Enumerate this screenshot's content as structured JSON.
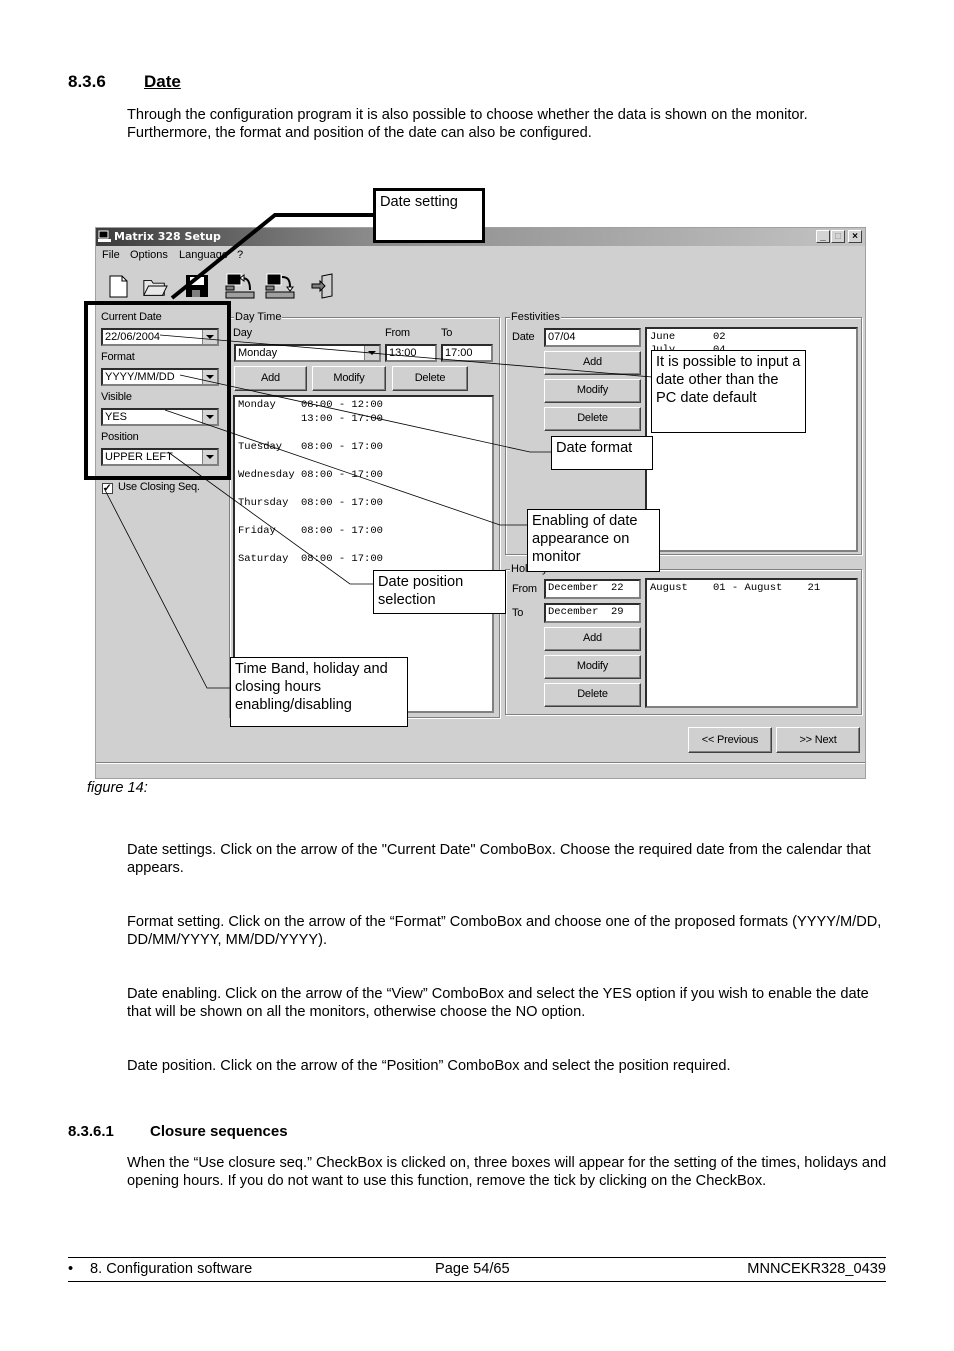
{
  "section": {
    "number": "8.3.6",
    "title": "Date"
  },
  "intro": [
    "Through the configuration program it is also possible to choose whether the data is shown on the monitor.",
    "Furthermore, the format and position of the date can also be configured."
  ],
  "window": {
    "title": "Matrix 328 Setup",
    "controls": {
      "minimize": "_",
      "maximize": "□",
      "close": "×"
    },
    "menu": [
      "File",
      "Options",
      "Language",
      "?"
    ],
    "toolbar": [
      "new-file-icon",
      "open-folder-icon",
      "save-floppy-icon",
      "receive-from-device-icon",
      "send-to-device-icon",
      "exit-door-icon"
    ],
    "date_panel": {
      "current_date_label": "Current Date",
      "current_date_value": "22/06/2004",
      "format_label": "Format",
      "format_value": "YYYY/MM/DD",
      "visible_label": "Visible",
      "visible_value": "YES",
      "position_label": "Position",
      "position_value": "UPPER LEFT",
      "closing_seq_label": "Use Closing Seq.",
      "closing_seq_checked": true
    },
    "day_time": {
      "title": "Day Time",
      "day_label": "Day",
      "from_label": "From",
      "to_label": "To",
      "day_value": "Monday",
      "from_value": "13:00",
      "to_value": "17:00",
      "add": "Add",
      "modify": "Modify",
      "delete": "Delete",
      "entries": [
        "Monday    08:00 - 12:00",
        "          13:00 - 17:00",
        "Tuesday   08:00 - 17:00",
        "Wednesday 08:00 - 17:00",
        "Thursday  08:00 - 17:00",
        "Friday    08:00 - 17:00",
        "Saturday  08:00 - 17:00"
      ]
    },
    "festivities": {
      "title": "Festivities",
      "date_label": "Date",
      "date_value": "07/04",
      "add": "Add",
      "modify": "Modify",
      "delete": "Delete",
      "entries": [
        "June      02",
        "July      04"
      ]
    },
    "holidays": {
      "title": "Holidays",
      "from_label": "From",
      "to_label": "To",
      "from_value": "December  22",
      "to_value": "December  29",
      "add": "Add",
      "modify": "Modify",
      "delete": "Delete",
      "entries": [
        "August    01 - August    21"
      ]
    },
    "nav": {
      "previous": "<< Previous",
      "next": ">> Next"
    }
  },
  "callouts": {
    "date_setting": "Date setting",
    "other_date": "It is possible to input a date other than the PC date default",
    "date_format": "Date format",
    "enabling": "Enabling of date appearance on monitor",
    "position": "Date position selection",
    "time_band": "Time Band, holiday and closing hours enabling/disabling"
  },
  "caption": "figure 14:",
  "body": [
    "Date settings. Click on the arrow of the \"Current Date\" ComboBox. Choose the required date from the calendar that appears.",
    "Format setting. Click on the arrow of the “Format” ComboBox and choose one of the proposed formats (YYYY/M/DD, DD/MM/YYYY, MM/DD/YYYY).",
    "Date enabling. Click on the arrow of the “View”  ComboBox and select the YES option if you wish to enable the date that will be shown on all the monitors, otherwise choose the NO option.",
    "Date position. Click on the arrow of the “Position” ComboBox and select the position required."
  ],
  "subsection": {
    "number": "8.3.6.1",
    "title": "Closure sequences"
  },
  "subsection_body": "When the “Use closure seq.” CheckBox is clicked on, three boxes will appear for the setting of the times, holidays and opening hours. If you do not want to use this function, remove the tick by clicking on the CheckBox.",
  "footer": {
    "bullet": "•",
    "chapter": "8. Configuration software",
    "page": "Page 54/65",
    "doc_id": "MNNCEKR328_0439"
  }
}
